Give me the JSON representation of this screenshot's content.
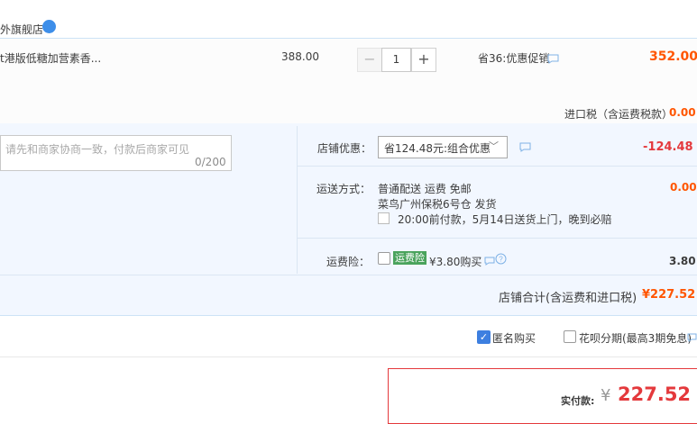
{
  "store": {
    "name": "外旗舰店",
    "badge": ""
  },
  "item": {
    "title": "t港版低糖加营素香...",
    "price": "388.00",
    "quantity": "1",
    "qty_minus": "−",
    "qty_plus": "+",
    "promo": "省36:优惠促销",
    "total": "352.00",
    "tax_label": "进口税（含运费税款）",
    "tax_value": "0.00"
  },
  "message": {
    "placeholder": "请先和商家协商一致，付款后商家可见",
    "count": "0/200"
  },
  "coupon": {
    "label": "店铺优惠：",
    "selected": "省124.48元:组合优惠",
    "caret": "﹀",
    "value": "-124.48"
  },
  "shipping": {
    "label": "运送方式：",
    "method": "普通配送 运费 免邮",
    "warehouse": "菜鸟广州保税6号仓   发货",
    "eta": "20:00前付款，5月14日送货上门，晚到必赔",
    "value": "0.00"
  },
  "insurance": {
    "label": "运费险：",
    "badge": "运费险",
    "price": "¥3.80购买",
    "help": "?",
    "value": "3.80"
  },
  "subtotal": {
    "label": "店铺合计(含运费和进口税)",
    "value": "¥227.52"
  },
  "options": {
    "anonymous": "匿名购买",
    "anonymous_check": "✓",
    "huabei": "花呗分期(最高3期免息)"
  },
  "payment": {
    "label": "实付款:",
    "currency": "¥",
    "amount": "227.52"
  },
  "colors": {
    "accent": "#f50",
    "price_red": "#e4393c",
    "link_blue": "#3d8ee9",
    "panel_bg": "#f2f7ff"
  }
}
